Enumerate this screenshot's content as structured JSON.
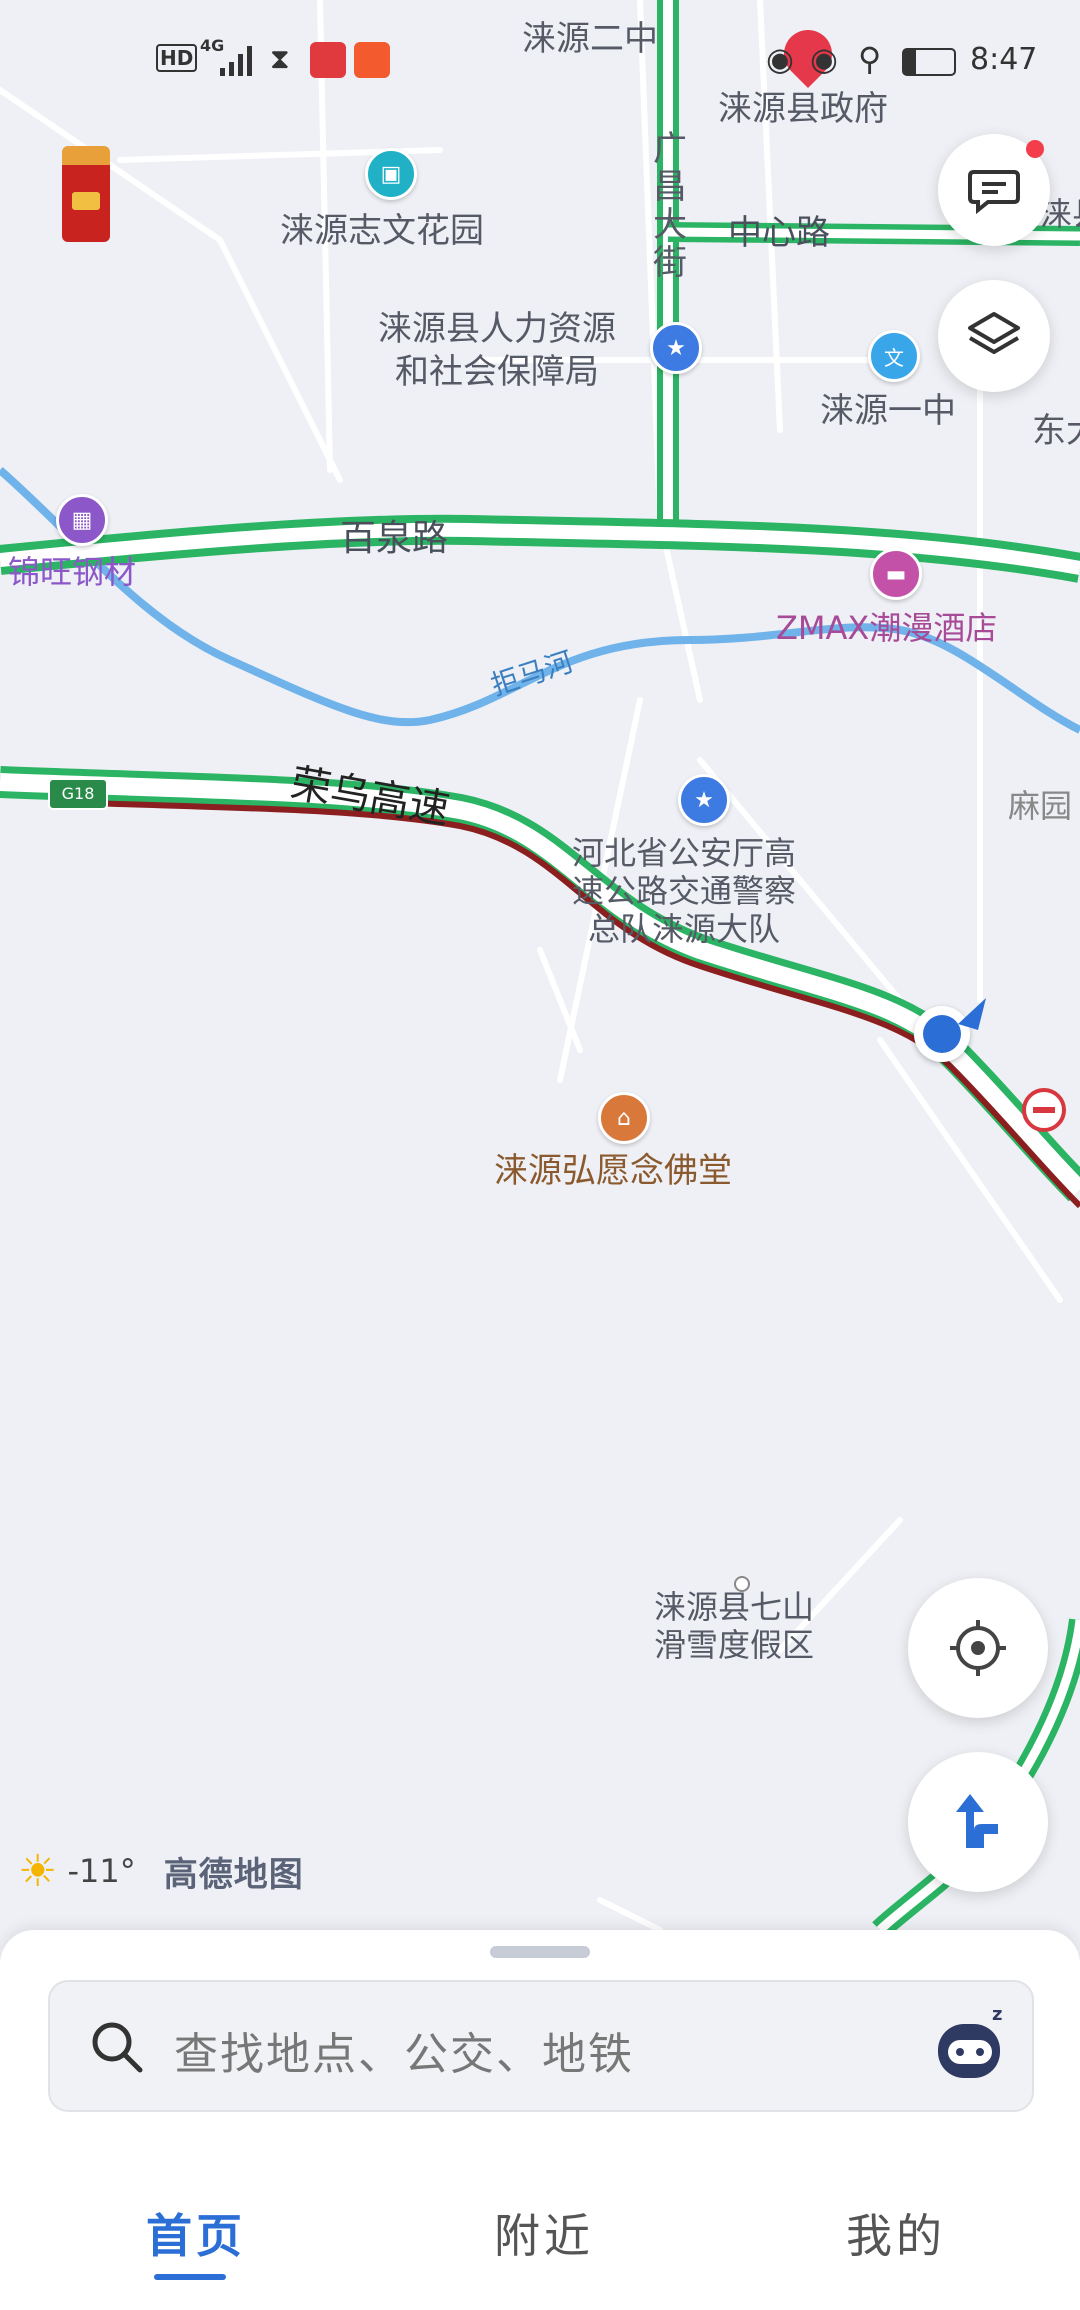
{
  "status_bar": {
    "left_icons": [
      "HD",
      "4G",
      "signal-bars",
      "hourglass-icon",
      "app-icon-red",
      "app-icon-video"
    ],
    "hd": "HD",
    "network": "4G",
    "right_icons": [
      "eye-icon",
      "eye-icon",
      "location-pin-icon",
      "battery-icon"
    ],
    "time": "8:47"
  },
  "map": {
    "roads": {
      "guangchang_street": "广昌大街",
      "center_road": "中心路",
      "baiquan_road": "百泉路",
      "rongwu_expressway": "荣乌高速",
      "g18_shield": "G18",
      "river": "拒马河"
    },
    "pois": {
      "laiyuan_no2_middle": "涞源二中",
      "county_government": "涞源县政府",
      "zhiwen_garden": "涞源志文花园",
      "hr_bureau": "涞源县人力资源\n和社会保障局",
      "laiyuan_no1_middle": "涞源一中",
      "jinwang_steel": "锦旺钢材",
      "zmax_hotel": "ZMAX潮漫酒店",
      "highway_police": "河北省公安厅高\n速公路交通警察\n总队涞源大队",
      "magyuan": "麻园",
      "buddha_hall": "涞源弘愿念佛堂",
      "ski_resort": "涞源县七山\n滑雪度假区",
      "east_partial": "东大",
      "county_partial": "涞县"
    },
    "poi_icon_names": [
      "building-icon",
      "star-icon",
      "school-icon",
      "shop-icon",
      "hotel-icon",
      "temple-icon"
    ]
  },
  "map_controls": {
    "message_icon": "message-icon",
    "layers_icon": "layers-icon",
    "locate_icon": "locate-icon",
    "navigate_icon": "navigate-icon"
  },
  "weather": {
    "icon": "sun-icon",
    "temperature": "-11°",
    "brand": "高德地图"
  },
  "search": {
    "placeholder": "查找地点、公交、地铁",
    "assistant_icon": "robot-assistant-icon"
  },
  "tabs": [
    {
      "label": "首页",
      "active": true
    },
    {
      "label": "附近",
      "active": false
    },
    {
      "label": "我的",
      "active": false
    }
  ],
  "colors": {
    "accent": "#2b6fd6",
    "road_green": "#2bb463",
    "road_jam": "#8b1e1e",
    "river": "#6fb3ea",
    "map_bg": "#eef0f5"
  }
}
